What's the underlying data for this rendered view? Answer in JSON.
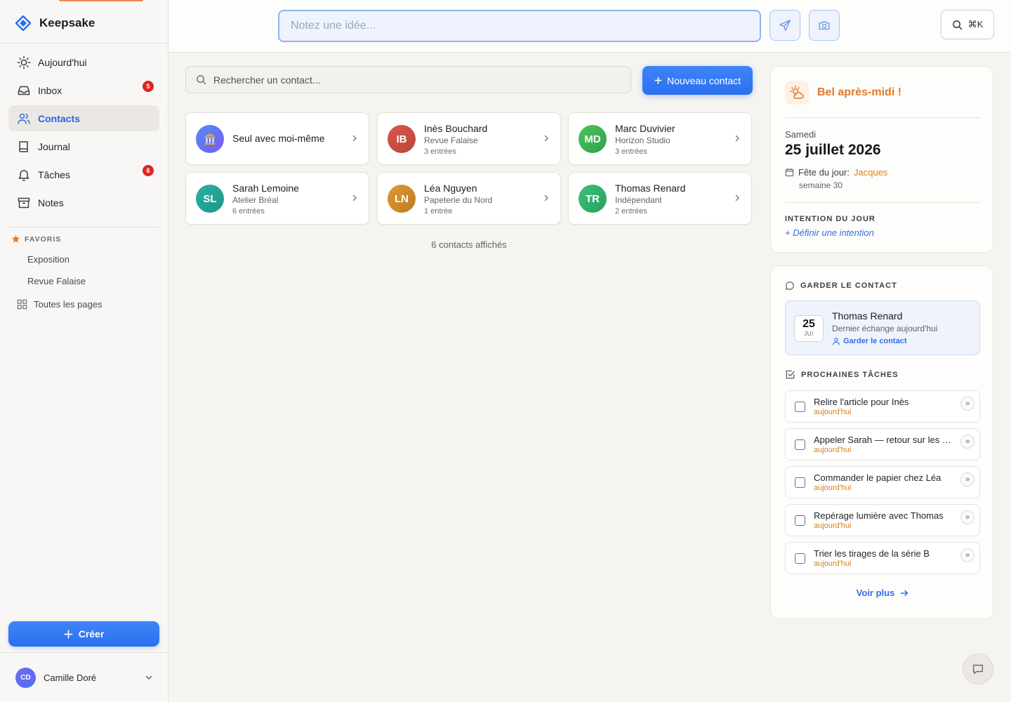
{
  "app": {
    "name": "Keepsake"
  },
  "nav": [
    {
      "label": "Aujourd'hui"
    },
    {
      "label": "Inbox",
      "badge": "5"
    },
    {
      "label": "Contacts",
      "active": true
    },
    {
      "label": "Journal"
    },
    {
      "label": "Tâches",
      "badge": "6"
    },
    {
      "label": "Notes"
    }
  ],
  "favorites": {
    "title": "FAVORIS",
    "items": [
      {
        "label": "Exposition"
      },
      {
        "label": "Revue Falaise"
      }
    ],
    "all_pages": "Toutes les pages"
  },
  "create_label": "Créer",
  "user": {
    "name": "Camille Doré",
    "initials": "CD"
  },
  "topbar": {
    "capture_placeholder": "Notez une idée...",
    "shortcut": "⌘K"
  },
  "contacts": {
    "search_placeholder": "Rechercher un contact...",
    "new_label": "Nouveau contact",
    "cards": [
      {
        "name": "Seul avec moi-même",
        "icon": "bank-icon",
        "color": "#5b6cf0"
      },
      {
        "name": "Inès Bouchard",
        "initials": "IB",
        "org": "Revue Falaise",
        "count": "3 entrées",
        "color": "#c94f3f"
      },
      {
        "name": "Marc Duvivier",
        "initials": "MD",
        "org": "Horizon Studio",
        "count": "3 entrées",
        "color": "#3fb950"
      },
      {
        "name": "Sarah Lemoine",
        "initials": "SL",
        "org": "Atelier Bréal",
        "count": "6 entrées",
        "color": "#22a69a"
      },
      {
        "name": "Léa Nguyen",
        "initials": "LN",
        "org": "Papeterie du Nord",
        "count": "1 entrée",
        "color": "#d0892a"
      },
      {
        "name": "Thomas Renard",
        "initials": "TR",
        "org": "Indépendant",
        "count": "2 entrées",
        "color": "#2fb56a"
      }
    ],
    "shown": "6 contacts affichés"
  },
  "today": {
    "greeting": "Bel après-midi !",
    "weekday": "Samedi",
    "date": "25 juillet 2026",
    "fete_label": "Fête du jour:",
    "fete_name": "Jacques",
    "week": "semaine 30",
    "intention_title": "INTENTION DU JOUR",
    "intention_link": "+ Définir une intention"
  },
  "keep_contact": {
    "title": "GARDER LE CONTACT",
    "day": "25",
    "month": "JUI",
    "name": "Thomas Renard",
    "last": "Dernier échange aujourd'hui",
    "action": "Garder le contact"
  },
  "tasks": {
    "title": "PROCHAINES TÂCHES",
    "items": [
      {
        "title": "Relire l'article pour Inès",
        "due": "aujourd'hui"
      },
      {
        "title": "Appeler Sarah — retour sur les maquettes",
        "due": "aujourd'hui"
      },
      {
        "title": "Commander le papier chez Léa",
        "due": "aujourd'hui"
      },
      {
        "title": "Repérage lumière avec Thomas",
        "due": "aujourd'hui"
      },
      {
        "title": "Trier les tirages de la série B",
        "due": "aujourd'hui"
      }
    ],
    "more": "Voir plus"
  },
  "colors": {
    "accent": "#2b6ff0",
    "warm": "#e0792a",
    "badge": "#dc2626"
  }
}
